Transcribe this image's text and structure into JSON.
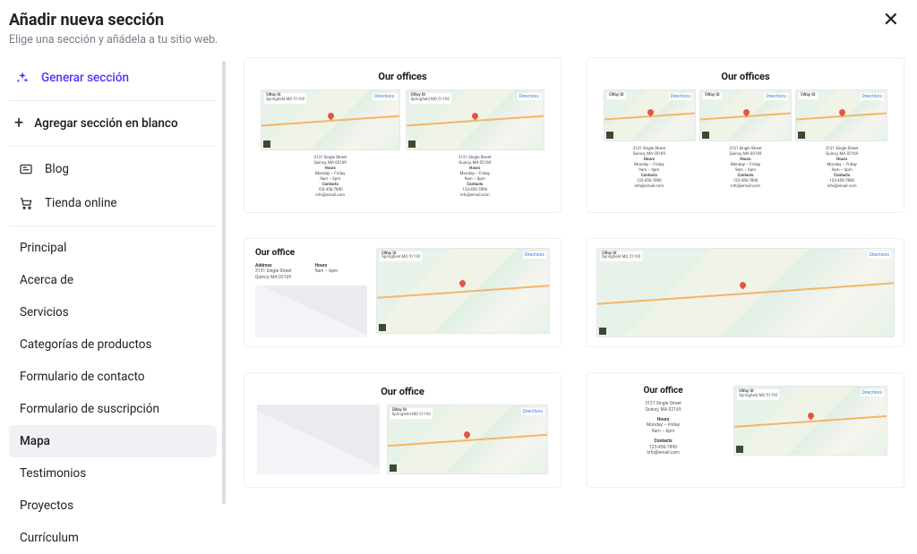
{
  "header": {
    "title": "Añadir nueva sección",
    "subtitle": "Elige una sección y añádela a tu sitio web."
  },
  "sidebar": {
    "generate": "Generar sección",
    "add_blank": "Agregar sección en blanco",
    "groups": [
      {
        "label": "Blog"
      },
      {
        "label": "Tienda online"
      }
    ],
    "categories": [
      "Principal",
      "Acerca de",
      "Servicios",
      "Categorías de productos",
      "Formulario de contacto",
      "Formulario de suscripción",
      "Mapa",
      "Testimonios",
      "Proyectos",
      "Currículum"
    ],
    "active_index": 6
  },
  "office_sample": {
    "address": "3131 Single Street",
    "city": "Quincy, MA 02169",
    "hours_label": "Hours",
    "hours1": "Monday – Friday",
    "hours2": "9am – 6pm",
    "contacts_label": "Contacts",
    "phone": "123-456-7890",
    "email": "info@email.com",
    "address_label": "Address",
    "map_tag_title": "5Way St",
    "map_tag_line": "Springfield MO 51192",
    "map_ctrl": "Directions"
  },
  "cards": {
    "c1_title": "Our offices",
    "c2_title": "Our offices",
    "c3_title": "Our office",
    "c5_title": "Our office",
    "c6_title": "Our office"
  }
}
